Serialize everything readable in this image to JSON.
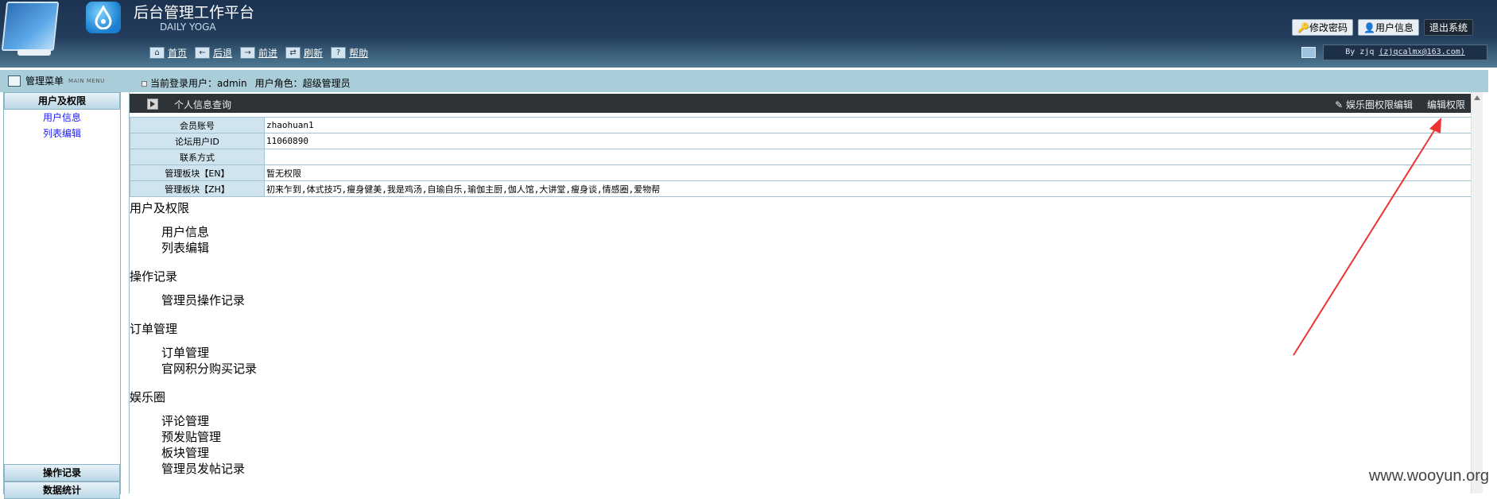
{
  "header": {
    "title": "后台管理工作平台",
    "subtitle": "DAILY YOGA",
    "actions": {
      "change_password": "修改密码",
      "user_info": "用户信息",
      "logout": "退出系统"
    },
    "nav": {
      "home": "首页",
      "back": "后退",
      "forward": "前进",
      "refresh": "刷新",
      "help": "帮助"
    },
    "byline_prefix": "By zjq",
    "byline_email": "(zjqcalmx@163.com)"
  },
  "infobar": {
    "menu_title": "管理菜单",
    "menu_sub": "MAIN MENU",
    "login_user": "当前登录用户：admin",
    "user_role": "用户角色：超级管理员"
  },
  "sidebar": {
    "group_users": "用户及权限",
    "links": [
      "用户信息",
      "列表编辑"
    ],
    "group_ops": "操作记录",
    "group_stats": "数据统计"
  },
  "main": {
    "panel_title": "个人信息查询",
    "action_yule": "娱乐圈权限编辑",
    "action_edit": "编辑权限",
    "rows": [
      {
        "label": "会员账号",
        "value": "zhaohuan1"
      },
      {
        "label": "论坛用户ID",
        "value": "11060890"
      },
      {
        "label": "联系方式",
        "value": ""
      },
      {
        "label": "管理板块【EN】",
        "value": "暂无权限"
      },
      {
        "label": "管理板块【ZH】",
        "value": "初来乍到,体式技巧,瘦身健美,我是鸡汤,自瑜自乐,瑜伽主厨,伽人馆,大讲堂,瘦身谈,情感圈,爱物帮"
      }
    ],
    "tree": [
      {
        "title": "用户及权限",
        "items": [
          "用户信息",
          "列表编辑"
        ]
      },
      {
        "title": "操作记录",
        "items": [
          "管理员操作记录"
        ]
      },
      {
        "title": "订单管理",
        "items": [
          "订单管理",
          "官网积分购买记录"
        ]
      },
      {
        "title": "娱乐圈",
        "items": [
          "评论管理",
          "预发贴管理",
          "板块管理",
          "管理员发帖记录"
        ]
      }
    ]
  },
  "watermark": "www.wooyun.org",
  "colors": {
    "header": "#1b3350",
    "infobar": "#a9cdd9",
    "darkbar": "#2e3338",
    "link": "#1a1aff",
    "arrow": "#ee3333"
  }
}
